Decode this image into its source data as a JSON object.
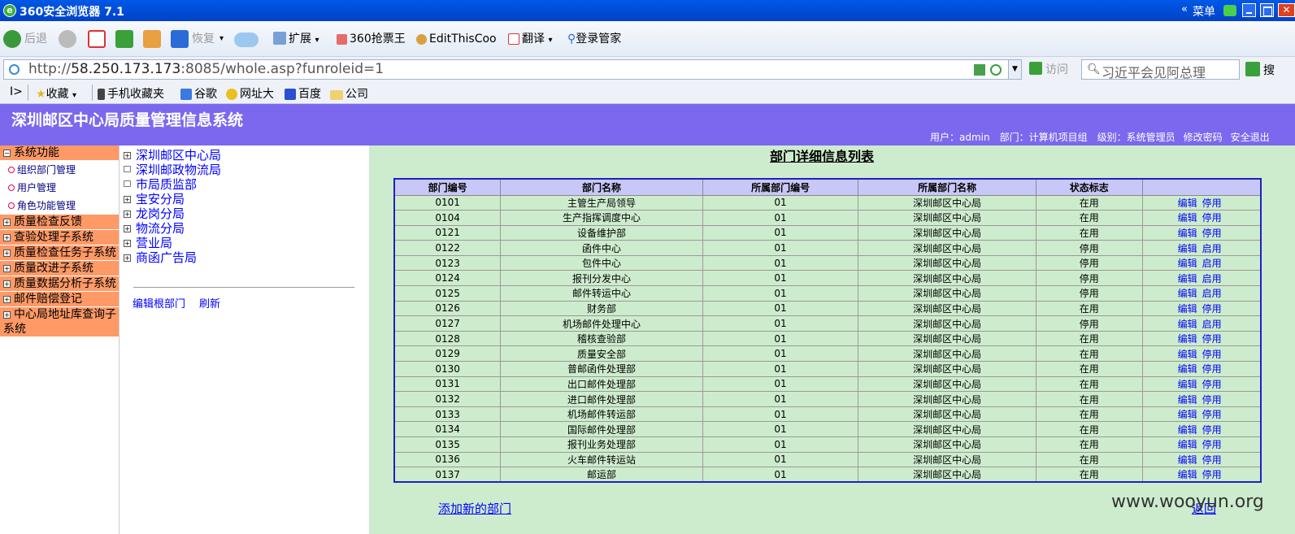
{
  "browser": {
    "title": "360安全浏览器 7.1",
    "menu_label": "菜单",
    "caret": "«",
    "close": "✕",
    "toolbar": {
      "back": "后退",
      "restore": "恢复",
      "extend": "扩展",
      "ticket": "360抢票王",
      "editthiscookie": "EditThisCoo",
      "translate": "翻译",
      "login": "登录管家"
    },
    "address": {
      "url_prefix": "http://",
      "url_host": "58.250.173.173",
      "url_rest": ":8085/whole.asp?funroleid=1",
      "visit": "访问",
      "search_placeholder": "习近平会见阿总理",
      "search_label": "搜"
    },
    "favorites": {
      "toggle": "I>",
      "favorites": "收藏",
      "items": [
        "手机收藏夹",
        "谷歌",
        "网址大",
        "百度",
        "公司"
      ]
    }
  },
  "app": {
    "system_title": "深圳邮区中心局质量管理信息系统",
    "user_info": "用户：admin　部门：计算机项目组　级别：系统管理员",
    "change_password": "修改密码",
    "safe_exit": "安全退出"
  },
  "left_menu": {
    "system_function": "系统功能",
    "sub_items": [
      "组织部门管理",
      "用户管理",
      "角色功能管理"
    ],
    "items": [
      "质量检查反馈",
      "查验处理子系统",
      "质量检查任务子系统",
      "质量改进子系统",
      "质量数据分析子系统",
      "邮件赔偿登记",
      "中心局地址库查询子系统"
    ]
  },
  "tree": {
    "nodes": [
      "深圳邮区中心局",
      "深圳邮政物流局",
      "市局质监部",
      "宝安分局",
      "龙岗分局",
      "物流分局",
      "营业局",
      "商函广告局"
    ],
    "edit_root": "编辑根部门",
    "refresh": "刷新"
  },
  "main": {
    "heading": "部门详细信息列表",
    "columns": [
      "部门编号",
      "部门名称",
      "所属部门编号",
      "所属部门名称",
      "状态标志",
      ""
    ],
    "edit_label": "编辑",
    "rows": [
      [
        "0101",
        "主管生产局领导",
        "01",
        "深圳邮区中心局",
        "在用",
        "停用"
      ],
      [
        "0104",
        "生产指挥调度中心",
        "01",
        "深圳邮区中心局",
        "在用",
        "停用"
      ],
      [
        "0121",
        "设备维护部",
        "01",
        "深圳邮区中心局",
        "在用",
        "停用"
      ],
      [
        "0122",
        "函件中心",
        "01",
        "深圳邮区中心局",
        "停用",
        "启用"
      ],
      [
        "0123",
        "包件中心",
        "01",
        "深圳邮区中心局",
        "停用",
        "启用"
      ],
      [
        "0124",
        "报刊分发中心",
        "01",
        "深圳邮区中心局",
        "停用",
        "启用"
      ],
      [
        "0125",
        "邮件转运中心",
        "01",
        "深圳邮区中心局",
        "停用",
        "启用"
      ],
      [
        "0126",
        "财务部",
        "01",
        "深圳邮区中心局",
        "在用",
        "停用"
      ],
      [
        "0127",
        "机场邮件处理中心",
        "01",
        "深圳邮区中心局",
        "停用",
        "启用"
      ],
      [
        "0128",
        "稽核查验部",
        "01",
        "深圳邮区中心局",
        "在用",
        "停用"
      ],
      [
        "0129",
        "质量安全部",
        "01",
        "深圳邮区中心局",
        "在用",
        "停用"
      ],
      [
        "0130",
        "普邮函件处理部",
        "01",
        "深圳邮区中心局",
        "在用",
        "停用"
      ],
      [
        "0131",
        "出口邮件处理部",
        "01",
        "深圳邮区中心局",
        "在用",
        "停用"
      ],
      [
        "0132",
        "进口邮件处理部",
        "01",
        "深圳邮区中心局",
        "在用",
        "停用"
      ],
      [
        "0133",
        "机场邮件转运部",
        "01",
        "深圳邮区中心局",
        "在用",
        "停用"
      ],
      [
        "0134",
        "国际邮件处理部",
        "01",
        "深圳邮区中心局",
        "在用",
        "停用"
      ],
      [
        "0135",
        "报刊业务处理部",
        "01",
        "深圳邮区中心局",
        "在用",
        "停用"
      ],
      [
        "0136",
        "火车邮件转运站",
        "01",
        "深圳邮区中心局",
        "在用",
        "停用"
      ],
      [
        "0137",
        "邮运部",
        "01",
        "深圳邮区中心局",
        "在用",
        "停用"
      ]
    ],
    "add_new": "添加新的部门",
    "back": "返回"
  },
  "watermark": "www.wooyun.org"
}
